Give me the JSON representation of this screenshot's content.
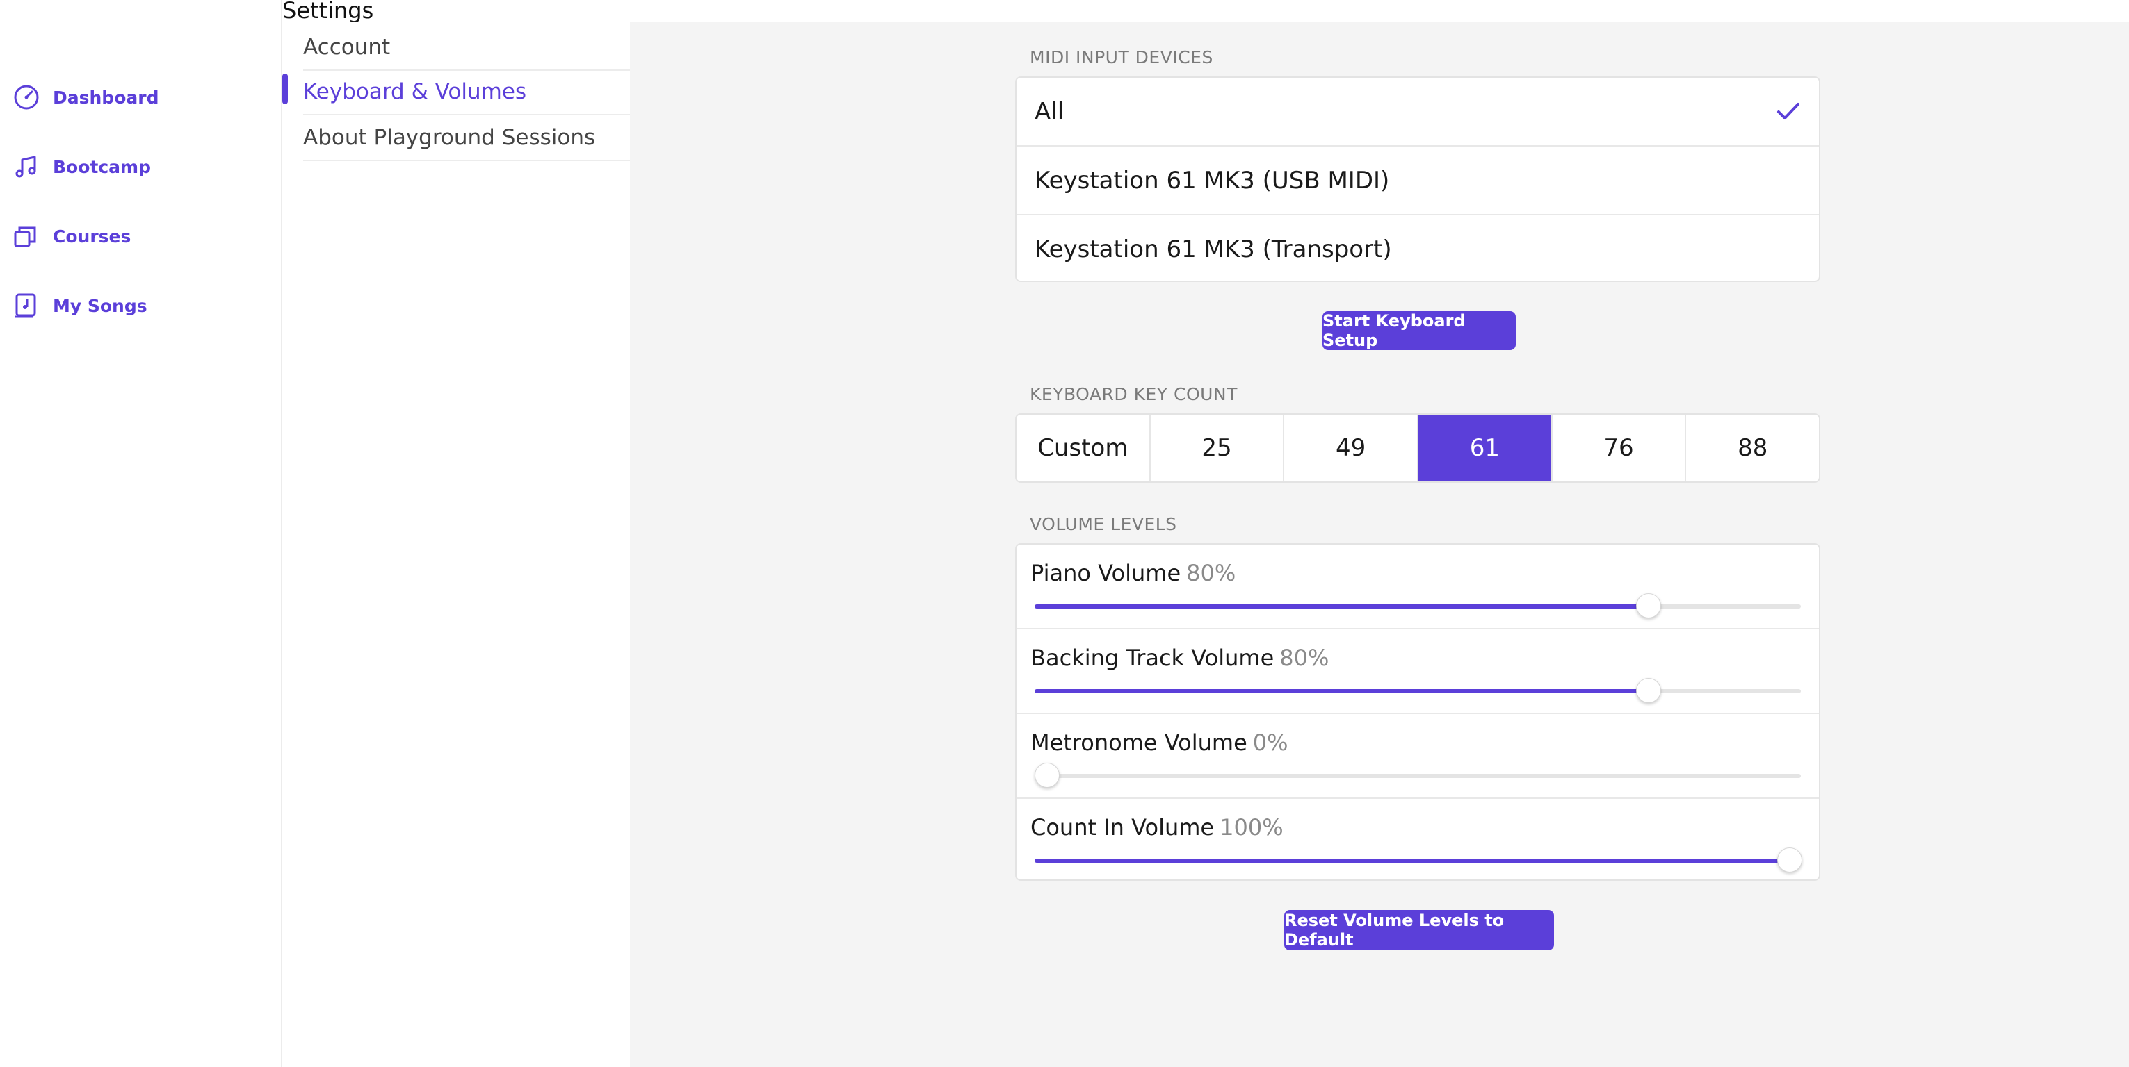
{
  "window": {
    "title": "Settings"
  },
  "nav": {
    "items": [
      {
        "label": "Dashboard",
        "icon": "dashboard-gauge-icon"
      },
      {
        "label": "Bootcamp",
        "icon": "music-note-icon"
      },
      {
        "label": "Courses",
        "icon": "stacked-cards-icon"
      },
      {
        "label": "My Songs",
        "icon": "song-book-icon"
      }
    ]
  },
  "settings": {
    "items": [
      {
        "label": "Account"
      },
      {
        "label": "Keyboard & Volumes"
      },
      {
        "label": "About Playground Sessions"
      }
    ],
    "active_index": 1
  },
  "midi": {
    "section_label": "MIDI INPUT DEVICES",
    "devices": [
      {
        "label": "All",
        "selected": true
      },
      {
        "label": "Keystation 61 MK3 (USB MIDI)",
        "selected": false
      },
      {
        "label": "Keystation 61 MK3 (Transport)",
        "selected": false
      }
    ],
    "setup_button": "Start Keyboard Setup"
  },
  "key_count": {
    "section_label": "KEYBOARD KEY COUNT",
    "options": [
      "Custom",
      "25",
      "49",
      "61",
      "76",
      "88"
    ],
    "selected": "61"
  },
  "volumes": {
    "section_label": "VOLUME LEVELS",
    "levels": [
      {
        "label": "Piano Volume",
        "percent_text": "80%",
        "value": 0.8
      },
      {
        "label": "Backing Track Volume",
        "percent_text": "80%",
        "value": 0.8
      },
      {
        "label": "Metronome Volume",
        "percent_text": "0%",
        "value": 0.0
      },
      {
        "label": "Count In Volume",
        "percent_text": "100%",
        "value": 1.0
      }
    ],
    "reset_button": "Reset Volume Levels to Default"
  },
  "colors": {
    "accent": "#5b3fd9",
    "background": "#f4f4f4"
  }
}
